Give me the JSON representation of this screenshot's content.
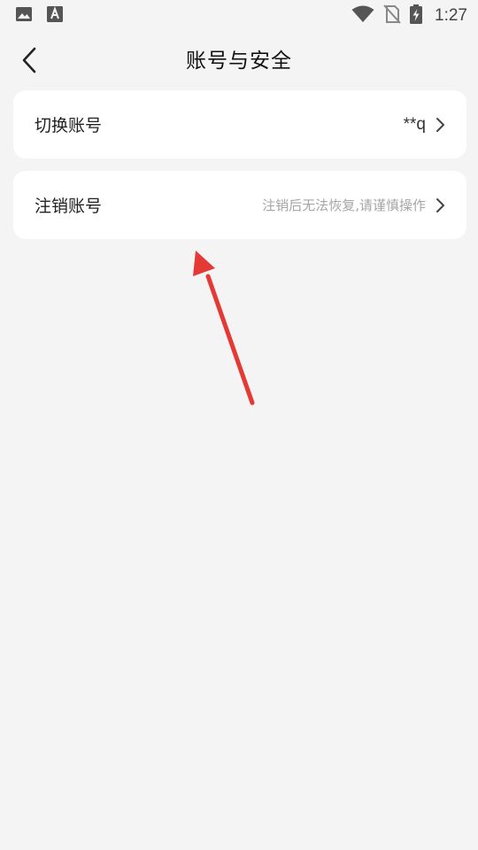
{
  "status_bar": {
    "time": "1:27",
    "left_icons": [
      "image-icon",
      "font-a-icon"
    ],
    "right_icons": [
      "wifi-icon",
      "no-sim-icon",
      "battery-charging-icon"
    ]
  },
  "nav": {
    "title": "账号与安全",
    "back_icon": "chevron-left-icon"
  },
  "items": [
    {
      "label": "切换账号",
      "value": "**q",
      "icon": "chevron-right-icon"
    },
    {
      "label": "注销账号",
      "hint": "注销后无法恢复,请谨慎操作",
      "icon": "chevron-right-icon"
    }
  ],
  "annotation": {
    "color": "#e53935"
  }
}
